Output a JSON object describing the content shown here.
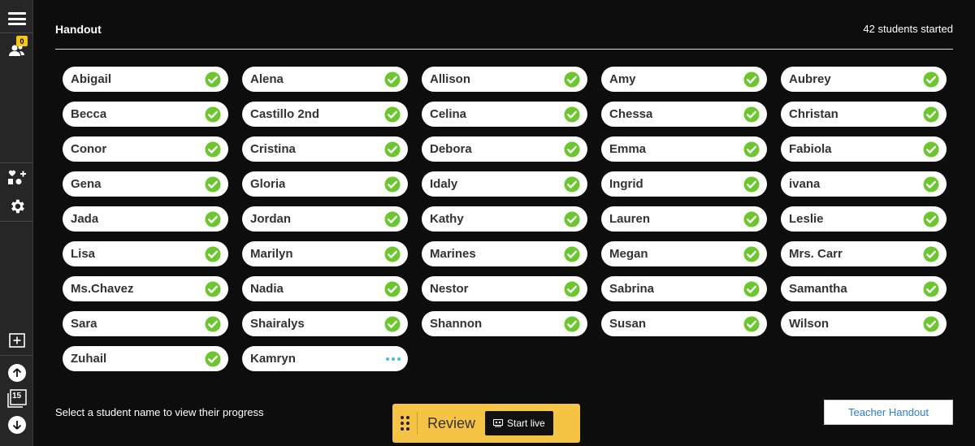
{
  "header": {
    "title": "Handout",
    "started": "42 students started"
  },
  "sidebar": {
    "students_badge": "0",
    "slides_count": "15",
    "icons": [
      "menu-icon",
      "students-icon",
      "add-student-slide-icon",
      "gear-icon",
      "add-slide-icon",
      "arrow-up-icon",
      "slides-icon",
      "arrow-down-icon"
    ]
  },
  "students": [
    {
      "name": "Abigail",
      "status": "done"
    },
    {
      "name": "Alena",
      "status": "done"
    },
    {
      "name": "Allison",
      "status": "done"
    },
    {
      "name": "Amy",
      "status": "done"
    },
    {
      "name": "Aubrey",
      "status": "done"
    },
    {
      "name": "Becca",
      "status": "done"
    },
    {
      "name": "Castillo 2nd",
      "status": "done"
    },
    {
      "name": "Celina",
      "status": "done"
    },
    {
      "name": "Chessa",
      "status": "done"
    },
    {
      "name": "Christan",
      "status": "done"
    },
    {
      "name": "Conor",
      "status": "done"
    },
    {
      "name": "Cristina",
      "status": "done"
    },
    {
      "name": "Debora",
      "status": "done"
    },
    {
      "name": "Emma",
      "status": "done"
    },
    {
      "name": "Fabiola",
      "status": "done"
    },
    {
      "name": "Gena",
      "status": "done"
    },
    {
      "name": "Gloria",
      "status": "done"
    },
    {
      "name": "Idaly",
      "status": "done"
    },
    {
      "name": "Ingrid",
      "status": "done"
    },
    {
      "name": "ivana",
      "status": "done"
    },
    {
      "name": "Jada",
      "status": "done"
    },
    {
      "name": "Jordan",
      "status": "done"
    },
    {
      "name": "Kathy",
      "status": "done"
    },
    {
      "name": "Lauren",
      "status": "done"
    },
    {
      "name": "Leslie",
      "status": "done"
    },
    {
      "name": "Lisa",
      "status": "done"
    },
    {
      "name": "Marilyn",
      "status": "done"
    },
    {
      "name": "Marines",
      "status": "done"
    },
    {
      "name": "Megan",
      "status": "done"
    },
    {
      "name": "Mrs. Carr",
      "status": "done"
    },
    {
      "name": "Ms.Chavez",
      "status": "done"
    },
    {
      "name": "Nadia",
      "status": "done"
    },
    {
      "name": "Nestor",
      "status": "done"
    },
    {
      "name": "Sabrina",
      "status": "done"
    },
    {
      "name": "Samantha",
      "status": "done"
    },
    {
      "name": "Sara",
      "status": "done"
    },
    {
      "name": "Shairalys",
      "status": "done"
    },
    {
      "name": "Shannon",
      "status": "done"
    },
    {
      "name": "Susan",
      "status": "done"
    },
    {
      "name": "Wilson",
      "status": "done"
    },
    {
      "name": "Zuhail",
      "status": "done"
    },
    {
      "name": "Kamryn",
      "status": "in-progress"
    }
  ],
  "footer": {
    "hint": "Select a student name to view their progress",
    "review_label": "Review",
    "start_live_label": "Start live",
    "teacher_handout_label": "Teacher Handout"
  },
  "colors": {
    "background": "#0d0d0d",
    "check_green": "#6cc72f",
    "review_yellow": "#f6c445",
    "link_blue": "#2a7de1",
    "badge_yellow": "#f5c518",
    "pending_blue": "#4fb7e6"
  }
}
